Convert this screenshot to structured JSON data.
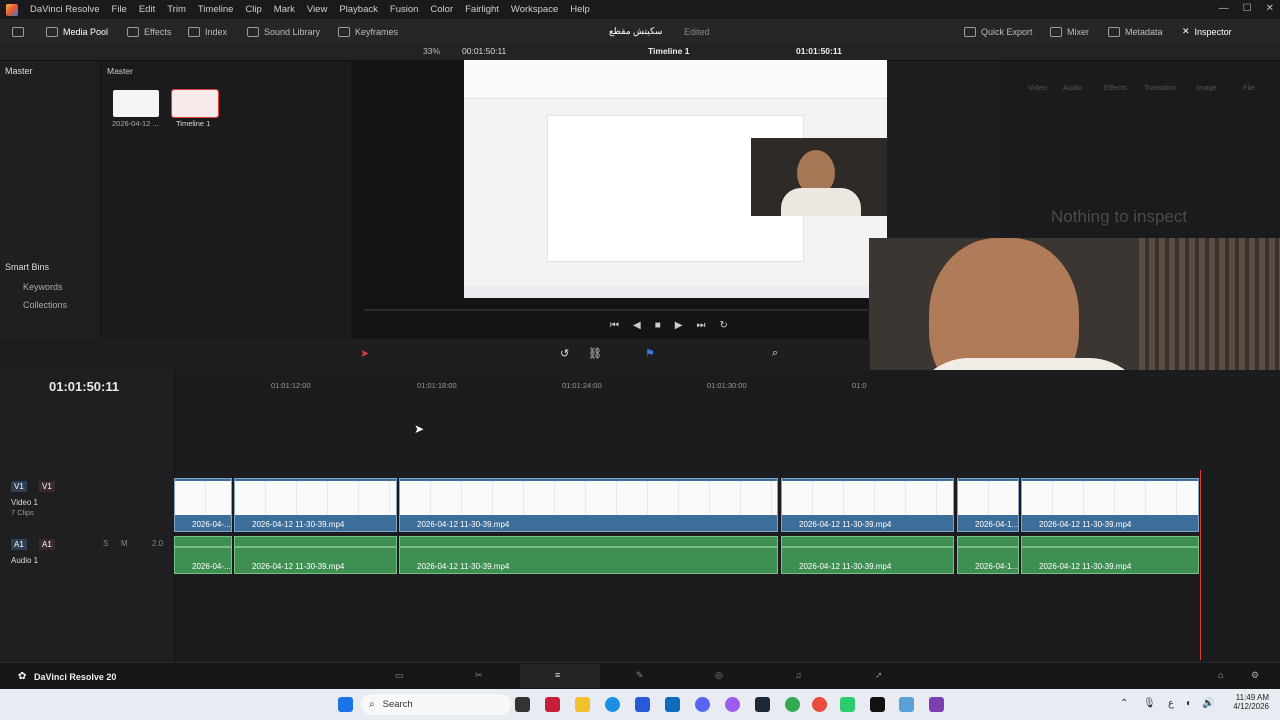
{
  "app": {
    "title": "DaVinci Resolve",
    "brand": "DaVinci Resolve 20"
  },
  "menu": [
    "File",
    "Edit",
    "Trim",
    "Timeline",
    "Clip",
    "Mark",
    "View",
    "Playback",
    "Fusion",
    "Color",
    "Fairlight",
    "Workspace",
    "Help"
  ],
  "toolbar": {
    "media_pool": "Media Pool",
    "effects": "Effects",
    "index": "Index",
    "sound_library": "Sound Library",
    "keyframes": "Keyframes",
    "project_name": "سكيتش مقطع",
    "edited": "Edited",
    "quick_export": "Quick Export",
    "mixer": "Mixer",
    "metadata": "Metadata",
    "inspector": "Inspector"
  },
  "viewer": {
    "zoom": "33%",
    "source_timecode": "00:01:50:11",
    "timeline_name": "Timeline 1",
    "record_timecode": "01:01:50:11"
  },
  "sidebar": {
    "master": "Master",
    "smart_bins": "Smart Bins",
    "keywords": "Keywords",
    "collections": "Collections"
  },
  "mediapool": {
    "header": "Master",
    "items": [
      {
        "label": "2026-04-12 ..."
      },
      {
        "label": "Timeline 1"
      }
    ]
  },
  "inspector": {
    "tabs": [
      "Video",
      "Audio",
      "Effects",
      "Transition",
      "Image",
      "File"
    ],
    "empty": "Nothing to inspect"
  },
  "timeline": {
    "timecode": "01:01:50:11",
    "ruler": [
      "01:01:12:00",
      "01:01:18:00",
      "01:01:24:00",
      "01:01:30:00",
      "01:0"
    ],
    "video_track": {
      "id": "V1",
      "name": "Video 1",
      "clips_count": "7 Clips"
    },
    "audio_track": {
      "id": "A1",
      "name": "Audio 1",
      "level": "2.0",
      "solo": "S",
      "mute": "M"
    },
    "clips": [
      "2026-04-...",
      "2026-04-12 11-30-39.mp4",
      "2026-04-12 11-30-39.mp4",
      "2026-04-12 11-30-39.mp4",
      "2026-04-1...",
      "2026-04-12 11-30-39.mp4"
    ],
    "audio_clips": [
      "2026-04-...",
      "2026-04-12 11-30-39.mp4",
      "2026-04-12 11-30-39.mp4",
      "2026-04-12 11-30-39.mp4",
      "2026-04-1...",
      "2026-04-12 11-30-39.mp4"
    ]
  },
  "taskbar": {
    "search": "Search",
    "time": "11:49 AM",
    "date": "4/12/2026",
    "lang": "ع"
  },
  "colors": {
    "video_clip": "#3d6d99",
    "audio_clip": "#3f8f52",
    "playhead": "#e23b3b",
    "accent": "#e03c3c"
  }
}
